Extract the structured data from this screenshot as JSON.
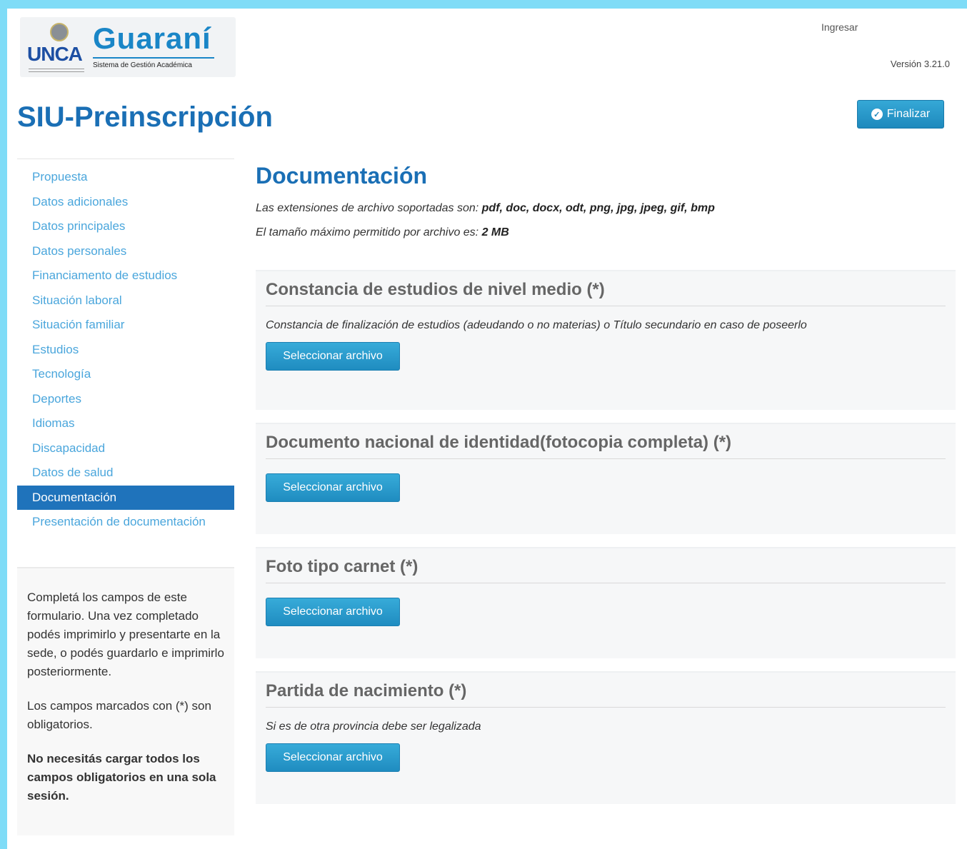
{
  "header": {
    "logo_unca": "UNCA",
    "logo_guarani": "Guaraní",
    "logo_tagline": "Sistema de Gestión Académica",
    "user_link": "Ingresar",
    "version": "Versión 3.21.0",
    "app_title": "SIU-Preinscripción",
    "finalize_label": "Finalizar"
  },
  "sidebar": {
    "items": [
      {
        "label": "Propuesta"
      },
      {
        "label": "Datos adicionales"
      },
      {
        "label": "Datos principales"
      },
      {
        "label": "Datos personales"
      },
      {
        "label": "Financiamento de estudios"
      },
      {
        "label": "Situación laboral"
      },
      {
        "label": "Situación familiar"
      },
      {
        "label": "Estudios"
      },
      {
        "label": "Tecnología"
      },
      {
        "label": "Deportes"
      },
      {
        "label": "Idiomas"
      },
      {
        "label": "Discapacidad"
      },
      {
        "label": "Datos de salud"
      },
      {
        "label": "Documentación",
        "active": true
      },
      {
        "label": "Presentación de documentación"
      }
    ],
    "help": {
      "p1": "Completá los campos de este formulario. Una vez completado podés imprimirlo y presentarte en la sede, o podés guardarlo e imprimirlo posteriormente.",
      "p2": "Los campos marcados con (*) son obligatorios.",
      "p3": "No necesitás cargar todos los campos obligatorios en una sola sesión."
    }
  },
  "main": {
    "title": "Documentación",
    "extensions_label": "Las extensiones de archivo soportadas son:",
    "extensions_value": "pdf, doc, docx, odt, png, jpg, jpeg, gif, bmp",
    "maxsize_label": "El tamaño máximo permitido por archivo es:",
    "maxsize_value": "2 MB",
    "sections": [
      {
        "title": "Constancia de estudios de nivel medio (*)",
        "description": "Constancia de finalización de estudios (adeudando o no materias) o Título secundario en caso de poseerlo",
        "button": "Seleccionar archivo"
      },
      {
        "title": "Documento nacional de identidad(fotocopia completa) (*)",
        "description": "",
        "button": "Seleccionar archivo"
      },
      {
        "title": "Foto tipo carnet (*)",
        "description": "",
        "button": "Seleccionar archivo"
      },
      {
        "title": "Partida de nacimiento (*)",
        "description": "Si es de otra provincia debe ser legalizada",
        "button": "Seleccionar archivo"
      }
    ]
  }
}
